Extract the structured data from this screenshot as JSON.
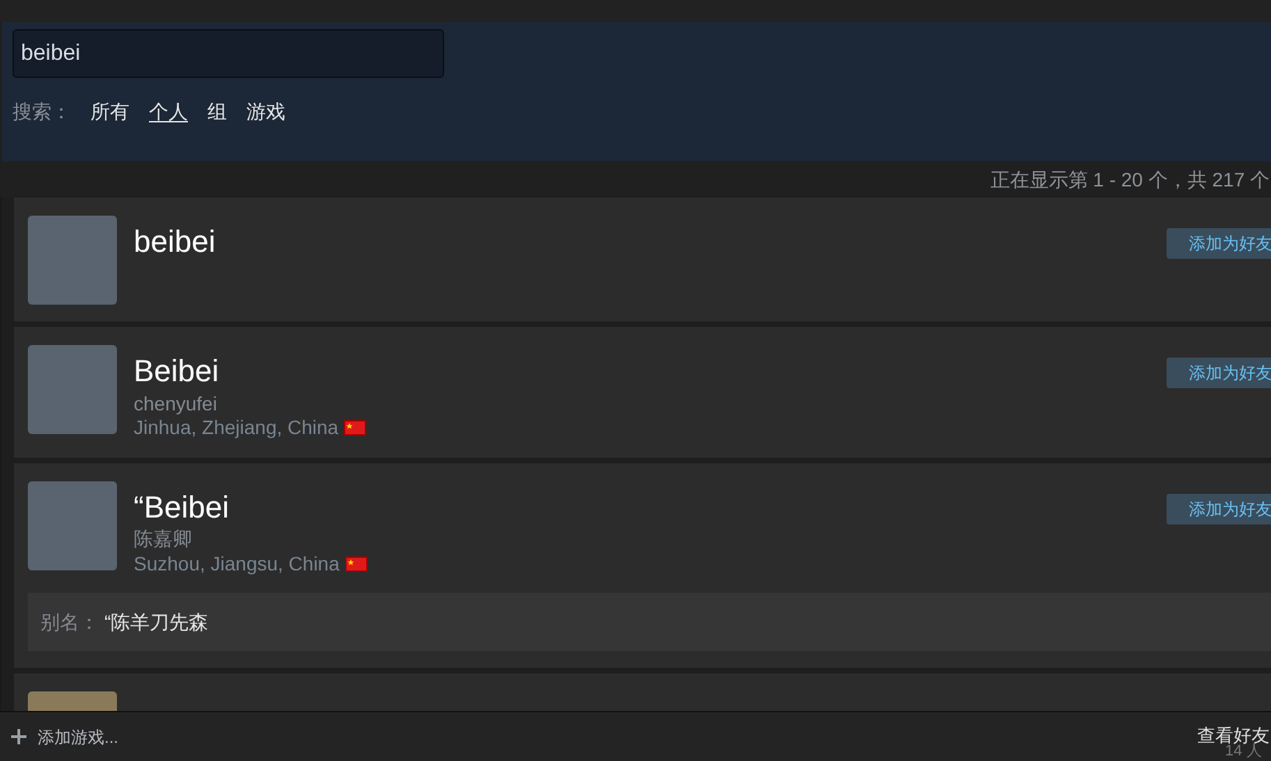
{
  "search": {
    "value": "beibei",
    "label": "搜索：",
    "filters": [
      {
        "label": "所有",
        "selected": false
      },
      {
        "label": "个人",
        "selected": true
      },
      {
        "label": "组",
        "selected": false
      },
      {
        "label": "游戏",
        "selected": false
      }
    ]
  },
  "results_summary": "正在显示第 1 - 20 个，共 217 个",
  "results": [
    {
      "name": "beibei",
      "button": "添加为好友"
    },
    {
      "name": "Beibei",
      "real_name": "chenyufei",
      "location": "Jinhua, Zhejiang, China",
      "button": "添加为好友"
    },
    {
      "name": "“Beibei",
      "real_name": "陈嘉卿",
      "location": "Suzhou, Jiangsu, China",
      "button": "添加为好友",
      "alias_label": "别名：",
      "alias": "“陈羊刀先森"
    }
  ],
  "bottom_bar": {
    "add_game": "添加游戏...",
    "friends": "查看好友",
    "friends_online": "14 人"
  }
}
